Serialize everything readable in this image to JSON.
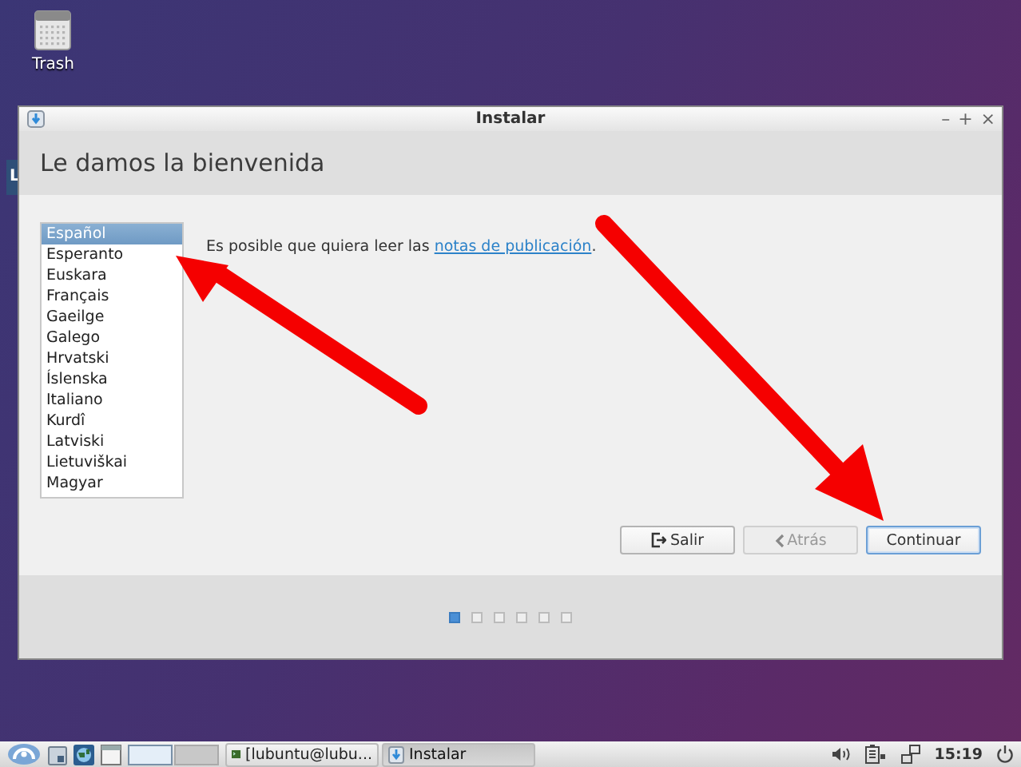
{
  "desktop": {
    "icons": [
      {
        "label": "Trash"
      }
    ],
    "background_window_label": "L"
  },
  "window": {
    "title": "Instalar",
    "controls": [
      "–",
      "+",
      "×"
    ]
  },
  "header": "Le damos la bienvenida",
  "languages": [
    {
      "label": "Español",
      "selected": true
    },
    {
      "label": "Esperanto",
      "selected": false
    },
    {
      "label": "Euskara",
      "selected": false
    },
    {
      "label": "Français",
      "selected": false
    },
    {
      "label": "Gaeilge",
      "selected": false
    },
    {
      "label": "Galego",
      "selected": false
    },
    {
      "label": "Hrvatski",
      "selected": false
    },
    {
      "label": "Íslenska",
      "selected": false
    },
    {
      "label": "Italiano",
      "selected": false
    },
    {
      "label": "Kurdî",
      "selected": false
    },
    {
      "label": "Latviski",
      "selected": false
    },
    {
      "label": "Lietuviškai",
      "selected": false
    },
    {
      "label": "Magyar",
      "selected": false
    }
  ],
  "release_notes": {
    "text": "Es posible que quiera leer las",
    "link": "notas de publicación",
    "suffix": "."
  },
  "buttons": [
    {
      "label": "Salir",
      "kind": "quit",
      "disabled": false,
      "default": false
    },
    {
      "label": "Atrás",
      "kind": "back",
      "disabled": true,
      "default": false
    },
    {
      "label": "Continuar",
      "kind": "next",
      "disabled": false,
      "default": true
    }
  ],
  "progress_dots": [
    {
      "selected": true
    },
    {
      "selected": false
    },
    {
      "selected": false
    },
    {
      "selected": false
    },
    {
      "selected": false
    },
    {
      "selected": false
    }
  ],
  "taskbar": {
    "pager": [
      {
        "selected": true
      },
      {
        "selected": false
      }
    ],
    "tasks": [
      {
        "label": "[lubuntu@lubu...",
        "kind": "terminal",
        "selected": false
      },
      {
        "label": "Instalar",
        "kind": "installer",
        "selected": true
      }
    ],
    "clock": "15:19"
  }
}
